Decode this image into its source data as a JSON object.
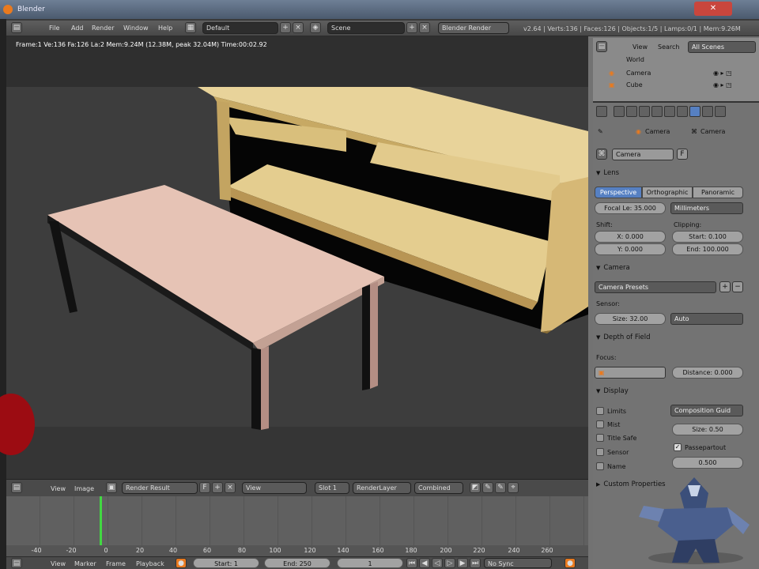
{
  "window": {
    "title": "Blender",
    "close_glyph": "✕"
  },
  "topbar": {
    "menus": [
      "File",
      "Add",
      "Render",
      "Window",
      "Help"
    ],
    "screen_layout": "Default",
    "scene": "Scene",
    "engine": "Blender Render",
    "stats": "v2.64 | Verts:136 | Faces:126 | Objects:1/5 | Lamps:0/1 | Mem:9.26M"
  },
  "viewport": {
    "info": "Frame:1 Ve:136 Fa:126 La:2 Mem:9.24M (12.38M, peak 32.04M) Time:00:02.92"
  },
  "image_editor": {
    "menus": [
      "View",
      "Image"
    ],
    "image": "Render Result",
    "f_label": "F",
    "view": "View",
    "slot": "Slot 1",
    "layer": "RenderLayer",
    "pass": "Combined"
  },
  "timeline": {
    "ruler": [
      "-40",
      "-20",
      "0",
      "20",
      "40",
      "60",
      "80",
      "100",
      "120",
      "140",
      "160",
      "180",
      "200",
      "220",
      "240",
      "260"
    ],
    "current_frame": 1
  },
  "bottom_bar": {
    "menus": [
      "View",
      "Marker",
      "Frame",
      "Playback"
    ],
    "start": "Start: 1",
    "end": "End: 250",
    "frame": "1",
    "sync": "No Sync"
  },
  "outliner": {
    "menus": [
      "View",
      "Search"
    ],
    "filter": "All Scenes",
    "items": [
      "World",
      "Camera",
      "Cube"
    ]
  },
  "properties": {
    "breadcrumb_a": "Camera",
    "breadcrumb_b": "Camera",
    "datablock": "Camera",
    "f_label": "F",
    "lens_header": "Lens",
    "lens_tabs": [
      "Perspective",
      "Orthographic",
      "Panoramic"
    ],
    "focal_length": "Focal Le: 35.000",
    "units": "Millimeters",
    "shift_label": "Shift:",
    "clipping_label": "Clipping:",
    "shift_x": "X: 0.000",
    "shift_y": "Y: 0.000",
    "clip_start": "Start: 0.100",
    "clip_end": "End: 100.000",
    "camera_header": "Camera",
    "camera_presets": "Camera Presets",
    "sensor_label": "Sensor:",
    "sensor_size": "Size: 32.00",
    "sensor_fit": "Auto",
    "dof_header": "Depth of Field",
    "focus_label": "Focus:",
    "distance": "Distance: 0.000",
    "display_header": "Display",
    "checks": [
      "Limits",
      "Mist",
      "Title Safe",
      "Sensor",
      "Name"
    ],
    "composition": "Composition Guid",
    "size": "Size: 0.50",
    "passepartout": "Passepartout",
    "alpha": "0.500",
    "custom_header": "Custom Properties"
  },
  "colors": {
    "accent_blue": "#5680c2",
    "frame_green": "#42d842",
    "table_pink": "#e6c3b5",
    "desk_yellow": "#e8d39a"
  }
}
